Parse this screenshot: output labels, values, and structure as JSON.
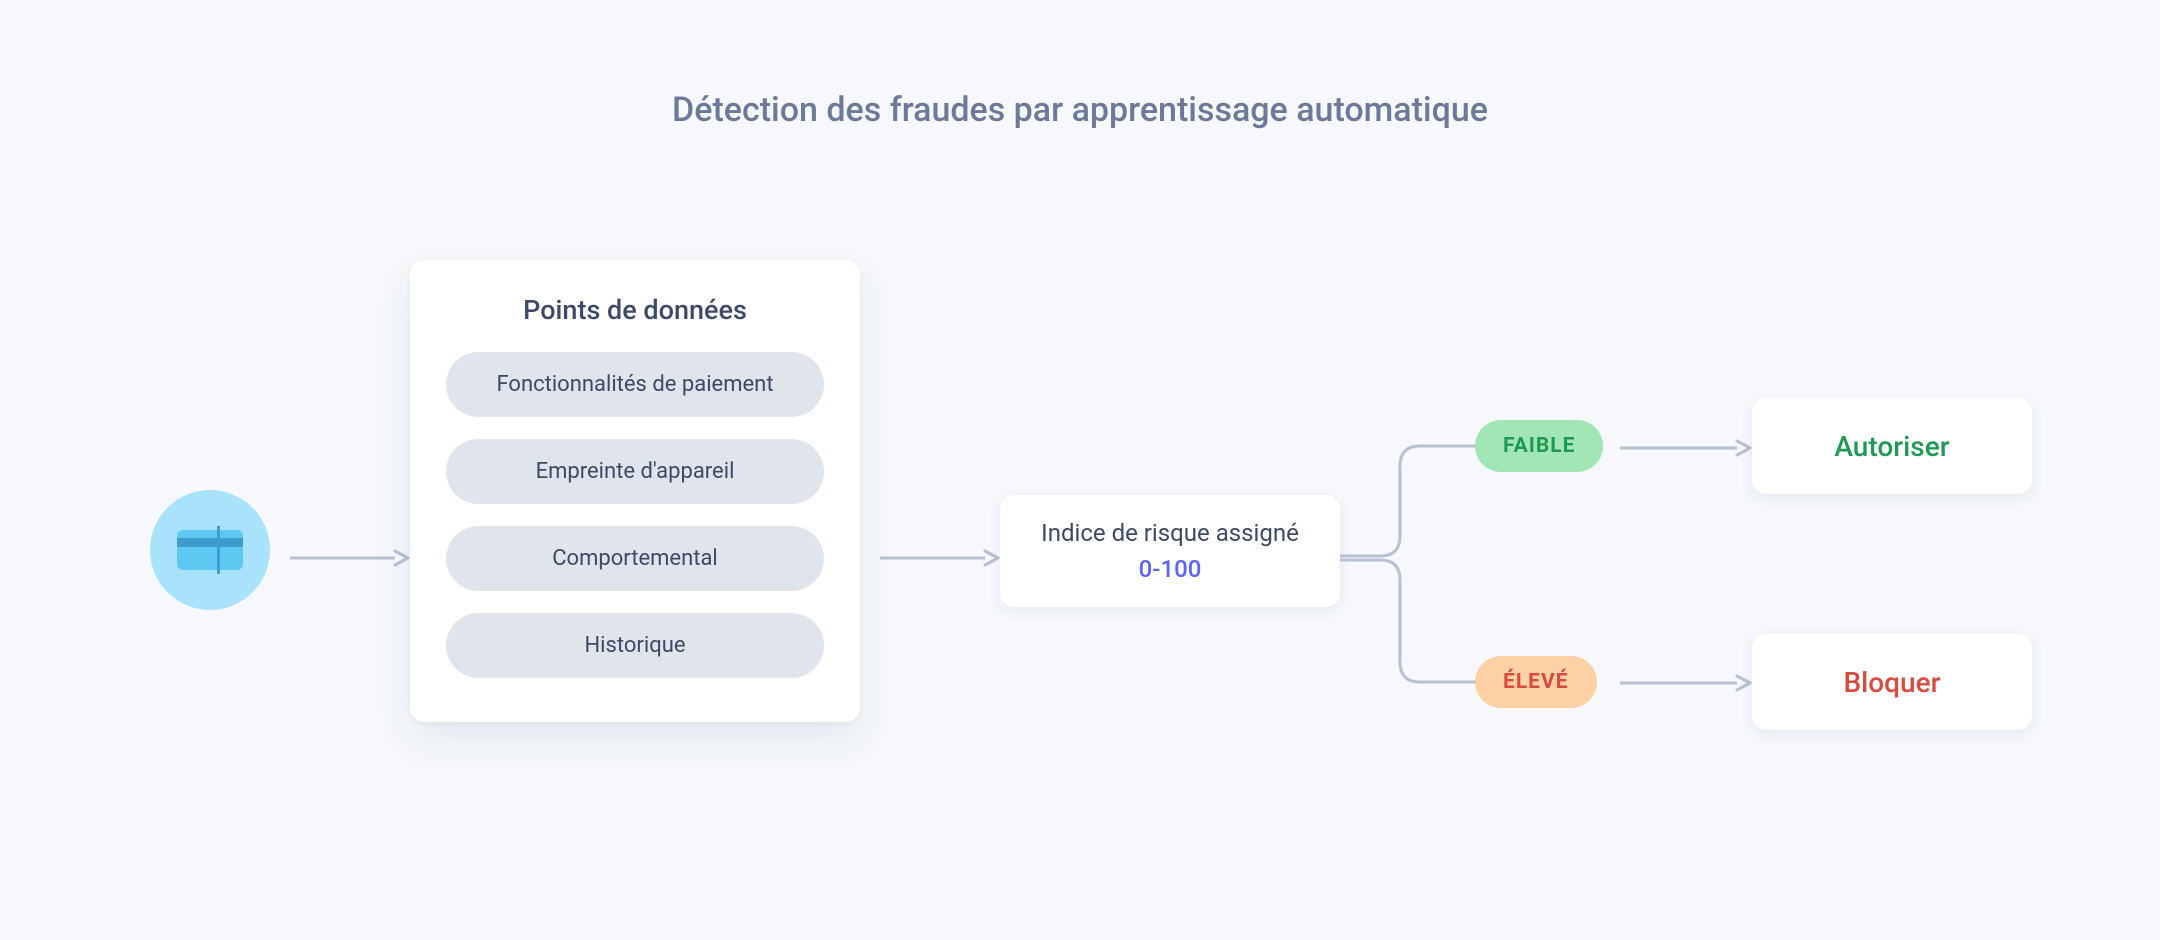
{
  "title": "Détection des fraudes par apprentissage automatique",
  "datapoints": {
    "heading": "Points de données",
    "items": [
      "Fonctionnalités de paiement",
      "Empreinte d'appareil",
      "Comportemental",
      "Historique"
    ]
  },
  "risk": {
    "label": "Indice de risque assigné",
    "range": "0-100"
  },
  "levels": {
    "low": "FAIBLE",
    "high": "ÉLEVÉ"
  },
  "outcomes": {
    "allow": "Autoriser",
    "block": "Bloquer"
  },
  "colors": {
    "arrow": "#b8c0d4"
  }
}
